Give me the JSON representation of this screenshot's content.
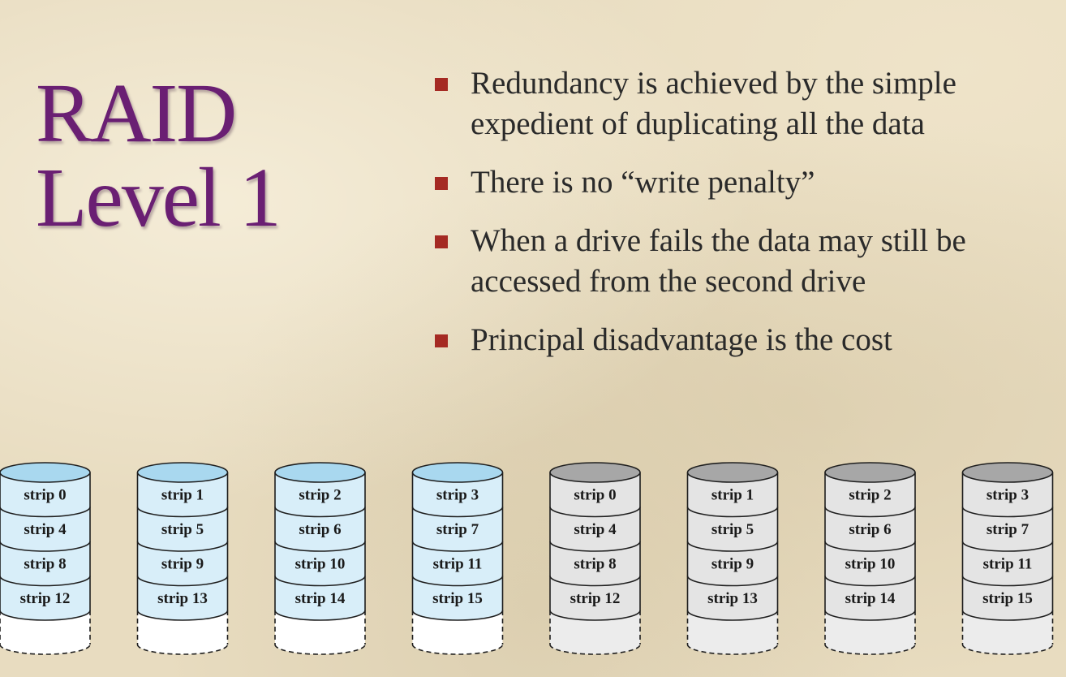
{
  "title": {
    "line1": "RAID",
    "line2": "Level 1"
  },
  "bullets": [
    "Redundancy is achieved by the simple expedient of duplicating all the data",
    "There is no “write penalty”",
    "When a drive fails the data may still be accessed from the second drive",
    "Principal disadvantage is the cost"
  ],
  "colors": {
    "title": "#6a1f73",
    "bullet_marker": "#a52a23",
    "primary_disk_top": "#a9d8ef",
    "primary_disk_body": "#d8eef9",
    "mirror_disk_top": "#a7a7a7",
    "mirror_disk_body": "#e4e4e4"
  },
  "disks": [
    {
      "group": "primary",
      "strips": [
        "strip 0",
        "strip 4",
        "strip 8",
        "strip 12"
      ]
    },
    {
      "group": "primary",
      "strips": [
        "strip 1",
        "strip 5",
        "strip 9",
        "strip 13"
      ]
    },
    {
      "group": "primary",
      "strips": [
        "strip 2",
        "strip 6",
        "strip 10",
        "strip 14"
      ]
    },
    {
      "group": "primary",
      "strips": [
        "strip 3",
        "strip 7",
        "strip 11",
        "strip 15"
      ]
    },
    {
      "group": "mirror",
      "strips": [
        "strip 0",
        "strip 4",
        "strip 8",
        "strip 12"
      ]
    },
    {
      "group": "mirror",
      "strips": [
        "strip 1",
        "strip 5",
        "strip 9",
        "strip 13"
      ]
    },
    {
      "group": "mirror",
      "strips": [
        "strip 2",
        "strip 6",
        "strip 10",
        "strip 14"
      ]
    },
    {
      "group": "mirror",
      "strips": [
        "strip 3",
        "strip 7",
        "strip 11",
        "strip 15"
      ]
    }
  ]
}
